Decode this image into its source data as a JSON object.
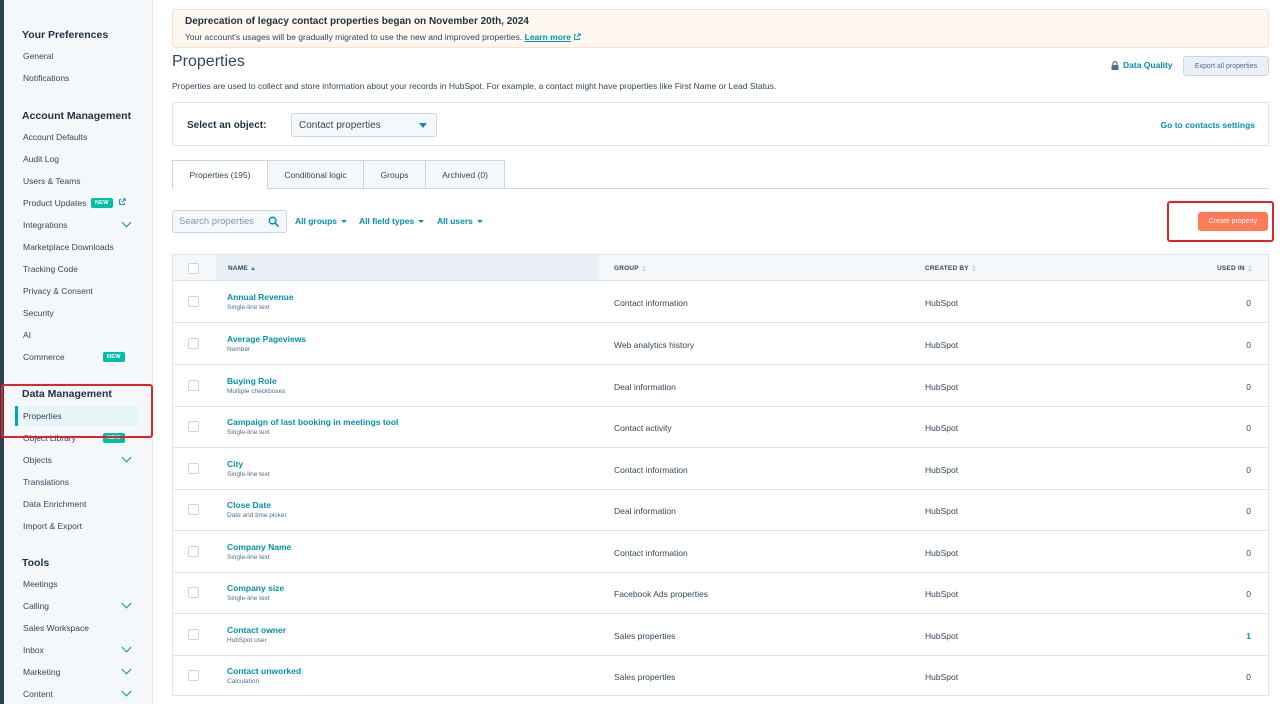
{
  "sidebar": {
    "sections": [
      {
        "title": "Your Preferences",
        "items": [
          "General",
          "Notifications"
        ]
      },
      {
        "title": "Account Management",
        "items": [
          "Account Defaults",
          "Audit Log",
          "Users & Teams",
          "Product Updates",
          "Integrations",
          "Marketplace Downloads",
          "Tracking Code",
          "Privacy & Consent",
          "Security",
          "AI",
          "Commerce"
        ]
      },
      {
        "title": "Data Management",
        "items": [
          "Properties",
          "Object Library",
          "Objects",
          "Translations",
          "Data Enrichment",
          "Import & Export"
        ]
      },
      {
        "title": "Tools",
        "items": [
          "Meetings",
          "Calling",
          "Sales Workspace",
          "Inbox",
          "Marketing",
          "Content"
        ]
      }
    ],
    "new_badge": "NEW"
  },
  "banner": {
    "title": "Deprecation of legacy contact properties began on November 20th, 2024",
    "text": "Your account's usages will be gradually migrated to use the new and improved properties.",
    "link": "Learn more"
  },
  "page": {
    "title": "Properties",
    "description": "Properties are used to collect and store information about your records in HubSpot. For example, a contact might have properties like First Name or Lead Status.",
    "data_quality": "Data Quality",
    "export_all": "Export all properties"
  },
  "object_selector": {
    "label": "Select an object:",
    "value": "Contact properties",
    "goto": "Go to contacts settings"
  },
  "tabs": [
    "Properties (195)",
    "Conditional logic",
    "Groups",
    "Archived (0)"
  ],
  "toolbar": {
    "search_placeholder": "Search properties",
    "filters": [
      "All groups",
      "All field types",
      "All users"
    ],
    "create": "Create property"
  },
  "table": {
    "headers": [
      "NAME",
      "GROUP",
      "CREATED BY",
      "USED IN"
    ],
    "rows": [
      {
        "name": "Annual Revenue",
        "type": "Single-line text",
        "group": "Contact information",
        "created_by": "HubSpot",
        "used_in": "0"
      },
      {
        "name": "Average Pageviews",
        "type": "Number",
        "group": "Web analytics history",
        "created_by": "HubSpot",
        "used_in": "0"
      },
      {
        "name": "Buying Role",
        "type": "Multiple checkboxes",
        "group": "Deal information",
        "created_by": "HubSpot",
        "used_in": "0"
      },
      {
        "name": "Campaign of last booking in meetings tool",
        "type": "Single-line text",
        "group": "Contact activity",
        "created_by": "HubSpot",
        "used_in": "0"
      },
      {
        "name": "City",
        "type": "Single-line text",
        "group": "Contact information",
        "created_by": "HubSpot",
        "used_in": "0"
      },
      {
        "name": "Close Date",
        "type": "Date and time picker",
        "group": "Deal information",
        "created_by": "HubSpot",
        "used_in": "0"
      },
      {
        "name": "Company Name",
        "type": "Single-line text",
        "group": "Contact information",
        "created_by": "HubSpot",
        "used_in": "0"
      },
      {
        "name": "Company size",
        "type": "Single-line text",
        "group": "Facebook Ads properties",
        "created_by": "HubSpot",
        "used_in": "0"
      },
      {
        "name": "Contact owner",
        "type": "HubSpot user",
        "group": "Sales properties",
        "created_by": "HubSpot",
        "used_in": "1"
      },
      {
        "name": "Contact unworked",
        "type": "Calculation",
        "group": "Sales properties",
        "created_by": "HubSpot",
        "used_in": "0"
      }
    ]
  },
  "colors": {
    "accent": "#0091ae",
    "primary_button": "#ff7a59",
    "active_nav": "#00a4bd",
    "annotation_red": "#e0242b"
  }
}
